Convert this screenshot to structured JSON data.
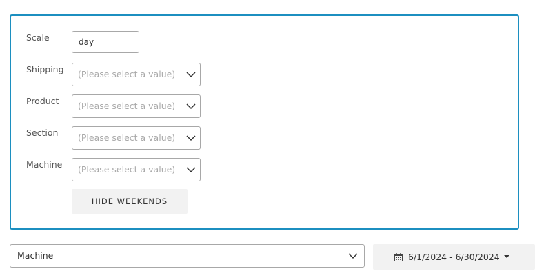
{
  "filters": {
    "scale": {
      "label": "Scale",
      "value": "day"
    },
    "shipping": {
      "label": "Shipping",
      "placeholder": "(Please select a value)"
    },
    "product": {
      "label": "Product",
      "placeholder": "(Please select a value)"
    },
    "section": {
      "label": "Section",
      "placeholder": "(Please select a value)"
    },
    "machine": {
      "label": "Machine",
      "placeholder": "(Please select a value)"
    },
    "hide_weekends_label": "HIDE WEEKENDS"
  },
  "bottom": {
    "group_by": {
      "value": "Machine"
    },
    "date_range": {
      "label": "6/1/2024 - 6/30/2024",
      "icon": "calendar-icon"
    }
  },
  "colors": {
    "panel_border": "#1c8fc0",
    "button_bg": "#f2f2f2",
    "placeholder_text": "#a9a9a9"
  }
}
